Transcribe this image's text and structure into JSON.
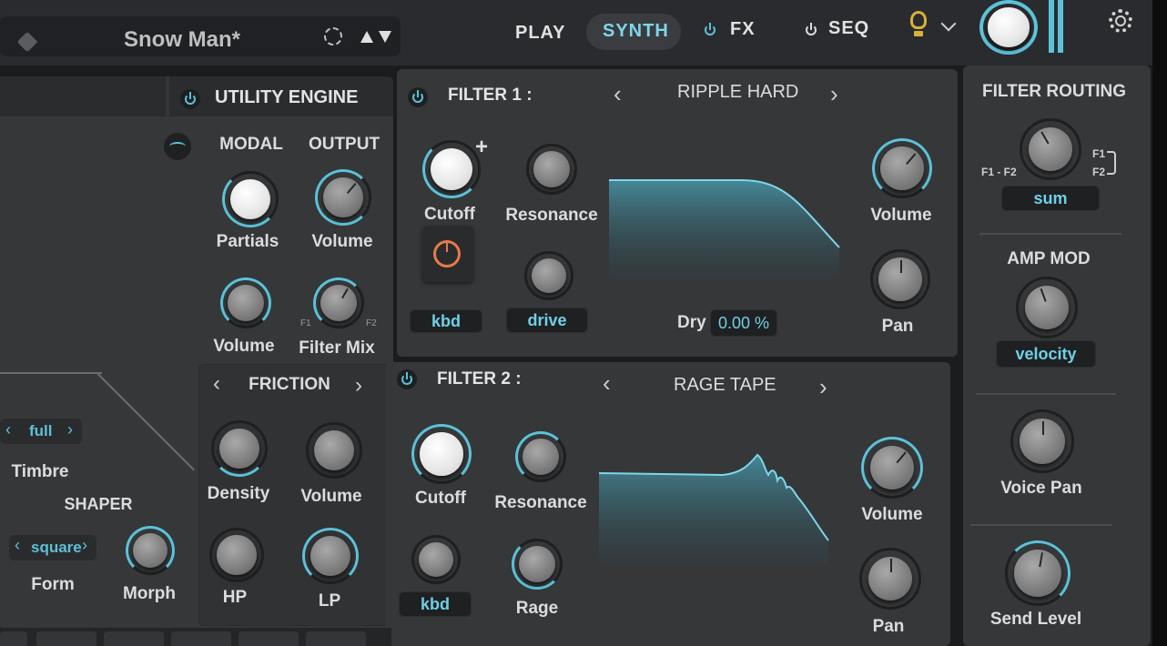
{
  "topbar": {
    "preset_name": "Snow Man*",
    "tabs": {
      "play": "PLAY",
      "synth": "SYNTH",
      "fx": "FX",
      "seq": "SEQ"
    }
  },
  "utility": {
    "title": "UTILITY ENGINE",
    "modal": "MODAL",
    "output": "OUTPUT",
    "partials": "Partials",
    "volume_out": "Volume",
    "volume_modal": "Volume",
    "filter_mix": "Filter Mix",
    "fm_f1": "F1",
    "fm_f2": "F2"
  },
  "shaper": {
    "timbre_value": "full",
    "timbre": "Timbre",
    "title": "SHAPER",
    "form_value": "square",
    "form": "Form",
    "morph": "Morph"
  },
  "friction": {
    "title": "FRICTION",
    "density": "Density",
    "volume": "Volume",
    "hp": "HP",
    "lp": "LP"
  },
  "filter1": {
    "title": "FILTER 1 :",
    "type": "RIPPLE HARD",
    "cutoff": "Cutoff",
    "plus": "+",
    "resonance": "Resonance",
    "kbd": "kbd",
    "drive": "drive",
    "dry_label": "Dry",
    "dry_value": "0.00 %",
    "volume": "Volume",
    "pan": "Pan"
  },
  "filter2": {
    "title": "FILTER 2 :",
    "type": "RAGE TAPE",
    "cutoff": "Cutoff",
    "resonance": "Resonance",
    "kbd": "kbd",
    "rage": "Rage",
    "volume": "Volume",
    "pan": "Pan"
  },
  "routing": {
    "title": "FILTER ROUTING",
    "f1f2": "F1 - F2",
    "f1": "F1",
    "f2": "F2",
    "mode": "sum",
    "amp_mod": "AMP MOD",
    "amp_mod_value": "velocity",
    "voice_pan": "Voice Pan",
    "send_level": "Send Level"
  },
  "colors": {
    "accent": "#5cc2d8",
    "panel": "#353739",
    "modulation": "#e87a4a",
    "bulb": "#d9b03a"
  }
}
